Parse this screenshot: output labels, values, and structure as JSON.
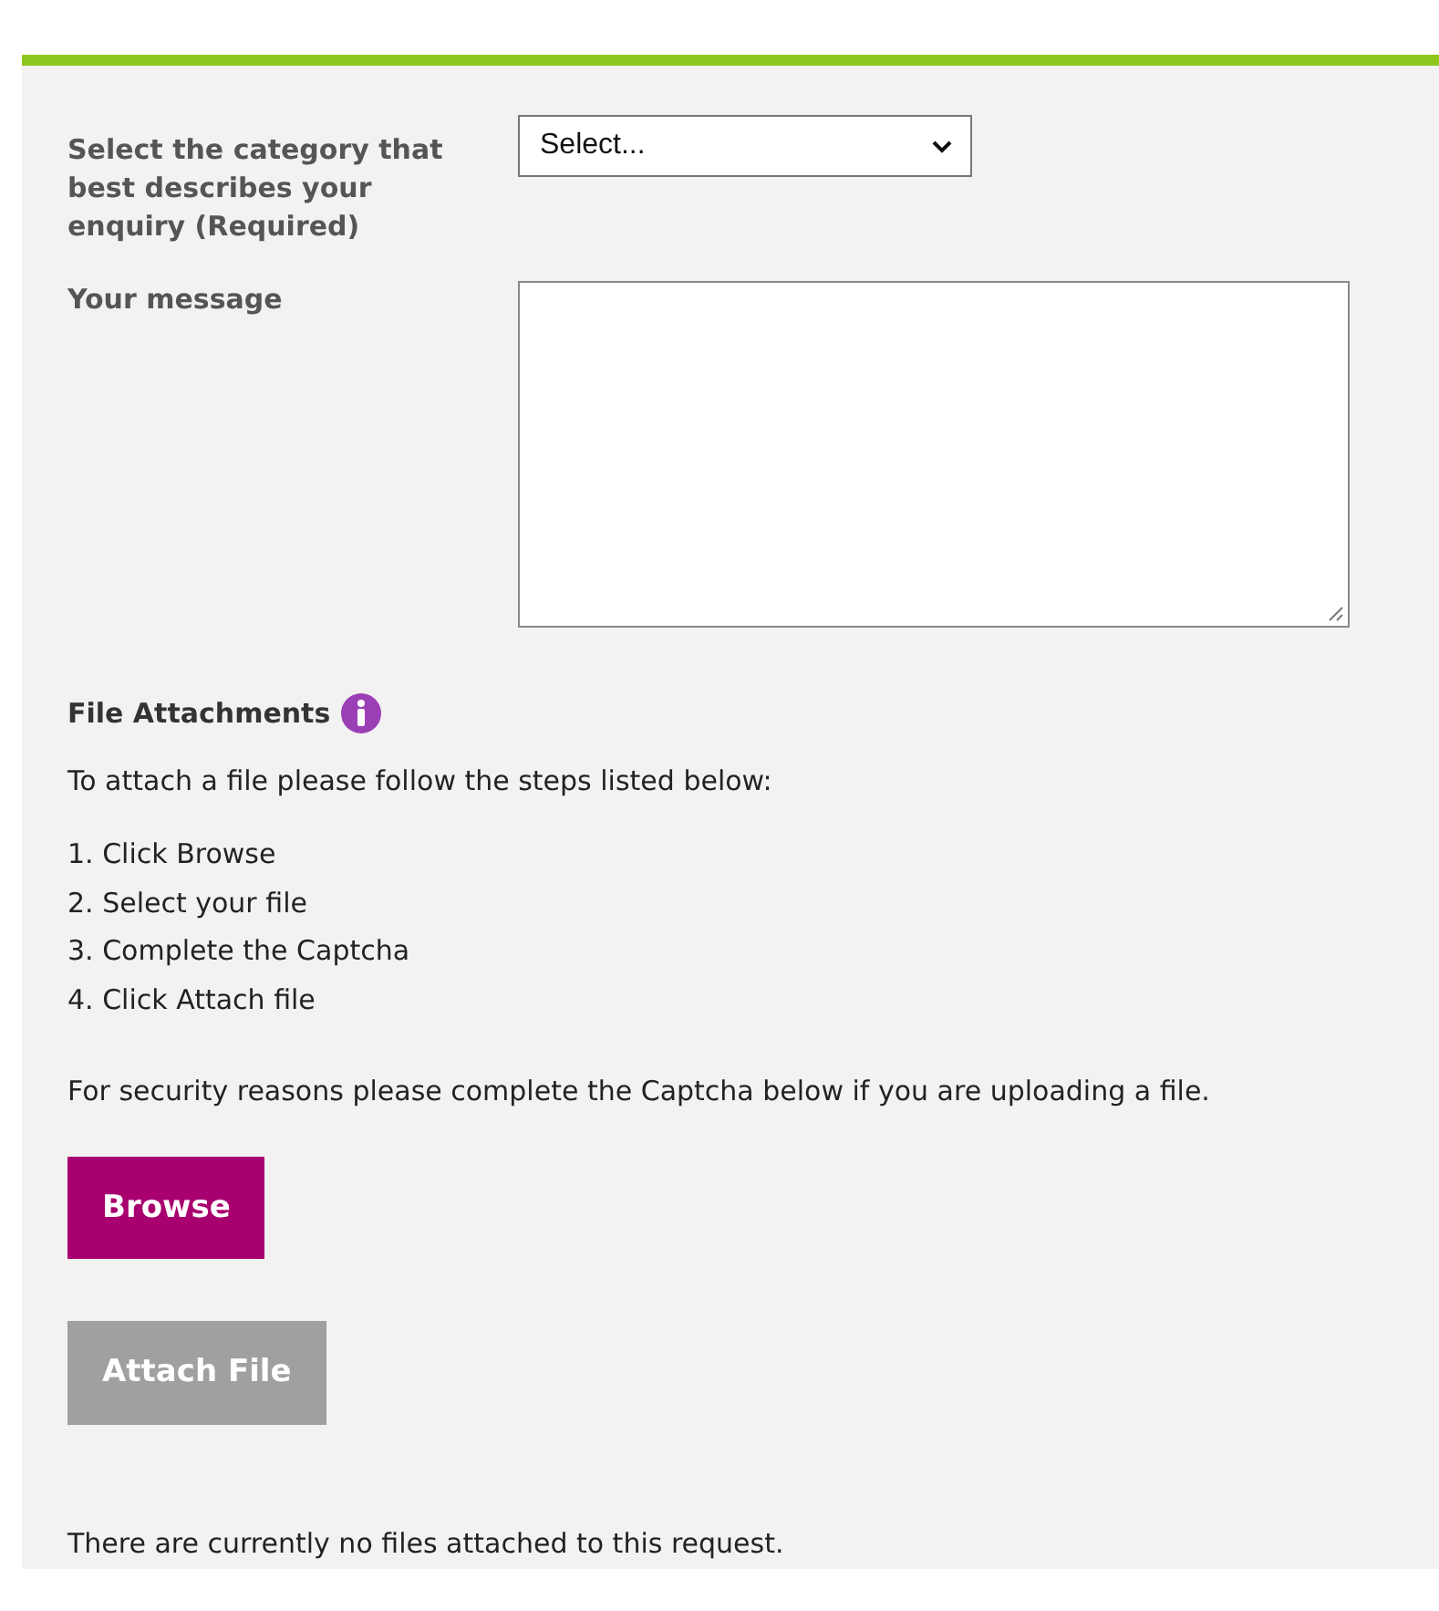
{
  "category": {
    "label": "Select the category that best describes your enquiry (Required)",
    "value": "Select..."
  },
  "message": {
    "label": "Your message"
  },
  "attachments": {
    "heading": "File Attachments",
    "intro": "To attach a file please follow the steps listed below:",
    "steps": [
      "1. Click Browse",
      "2. Select your file",
      "3. Complete the Captcha",
      "4. Click Attach file"
    ],
    "security_note": "For security reasons please complete the Captcha below if you are uploading a file.",
    "buttons": [
      {
        "label": "Browse",
        "disabled": false
      },
      {
        "label": "Attach File",
        "disabled": true
      }
    ],
    "status": "There are currently no files attached to this request."
  }
}
